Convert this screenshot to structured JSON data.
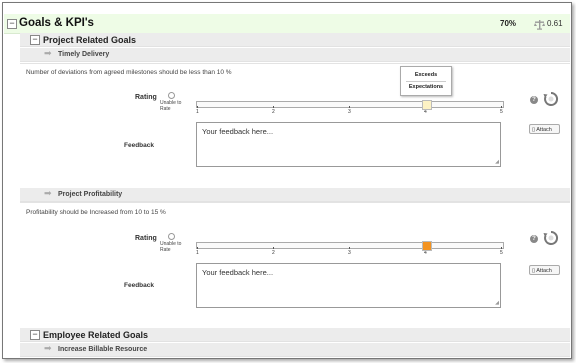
{
  "goals": {
    "title": "Goals & KPI's",
    "percent": "70%",
    "score": "0.61",
    "toggle": "−"
  },
  "project_goals": {
    "title": "Project Related Goals",
    "toggle": "−"
  },
  "employee_goals": {
    "title": "Employee Related Goals",
    "toggle": "−"
  },
  "kpis": [
    {
      "title": "Timely Delivery",
      "description": "Number of deviations from agreed milestones should be less than 10 %",
      "rating_label": "Rating",
      "unable_line1": "Unable to",
      "unable_line2": "Rate",
      "ticks": [
        "1",
        "2",
        "3",
        "4",
        "5"
      ],
      "selected": 4,
      "thumb_color": "#fdf2c4",
      "tooltip_line1": "Exceeds",
      "tooltip_line2": "Expectations",
      "feedback_label": "Feedback",
      "feedback_placeholder": "Your feedback here...",
      "attach_label": "Attach",
      "help": "?"
    },
    {
      "title": "Project Profitability",
      "description": "Profitability should be Increased from 10 to 15 %",
      "rating_label": "Rating",
      "unable_line1": "Unable to",
      "unable_line2": "Rate",
      "ticks": [
        "1",
        "2",
        "3",
        "4",
        "5"
      ],
      "selected": 4,
      "thumb_color": "#f39320",
      "feedback_label": "Feedback",
      "feedback_placeholder": "Your feedback here...",
      "attach_label": "Attach",
      "help": "?"
    },
    {
      "title": "Increase Billable Resource"
    }
  ]
}
